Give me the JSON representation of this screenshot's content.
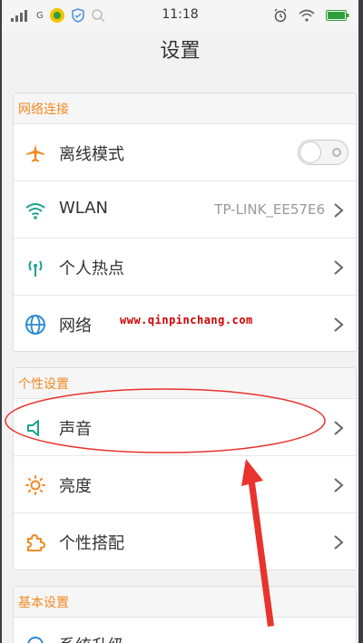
{
  "status_bar": {
    "network_type": "G",
    "time": "11:18"
  },
  "header": {
    "title": "设置"
  },
  "sections": [
    {
      "title": "网络连接",
      "items": [
        {
          "label": "离线模式",
          "icon": "airplane-icon",
          "control": "toggle",
          "toggle_on": false
        },
        {
          "label": "WLAN",
          "icon": "wifi-icon",
          "value": "TP-LINK_EE57E6"
        },
        {
          "label": "个人热点",
          "icon": "hotspot-icon"
        },
        {
          "label": "网络",
          "icon": "globe-icon"
        }
      ]
    },
    {
      "title": "个性设置",
      "items": [
        {
          "label": "声音",
          "icon": "speaker-icon"
        },
        {
          "label": "亮度",
          "icon": "brightness-icon"
        },
        {
          "label": "个性搭配",
          "icon": "puzzle-icon"
        }
      ]
    },
    {
      "title": "基本设置",
      "items": [
        {
          "label": "系统升级",
          "icon": "system-icon"
        }
      ]
    }
  ],
  "watermark": "www.qinpinchang.com",
  "colors": {
    "section_title": "#f08a24",
    "icon_teal": "#1aa38c",
    "icon_orange": "#f08a24",
    "icon_blue": "#2b8ad4",
    "annotation_red": "#e8332e"
  }
}
